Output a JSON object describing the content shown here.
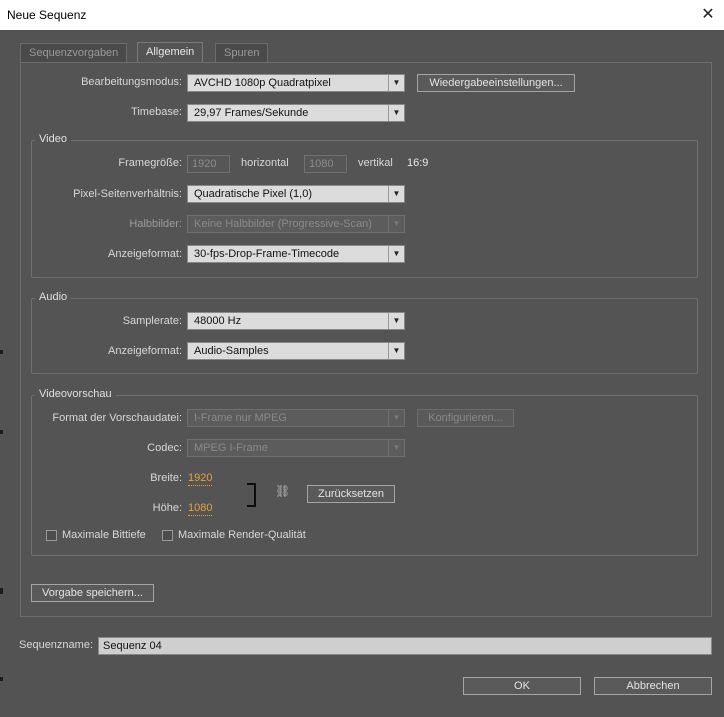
{
  "window": {
    "title": "Neue Sequenz"
  },
  "tabs": [
    {
      "label": "Sequenzvorgaben",
      "active": false
    },
    {
      "label": "Allgemein",
      "active": true
    },
    {
      "label": "Spuren",
      "active": false
    }
  ],
  "general": {
    "editing_mode_label": "Bearbeitungsmodus:",
    "editing_mode_value": "AVCHD 1080p Quadratpixel",
    "playback_settings_button": "Wiedergabeeinstellungen...",
    "timebase_label": "Timebase:",
    "timebase_value": "29,97 Frames/Sekunde"
  },
  "video": {
    "group_title": "Video",
    "frame_size_label": "Framegröße:",
    "frame_width": "1920",
    "horizontal_label": "horizontal",
    "frame_height": "1080",
    "vertical_label": "vertikal",
    "aspect_ratio": "16:9",
    "pixel_aspect_label": "Pixel-Seitenverhältnis:",
    "pixel_aspect_value": "Quadratische Pixel (1,0)",
    "fields_label": "Halbbilder:",
    "fields_value": "Keine Halbbilder (Progressive-Scan)",
    "display_format_label": "Anzeigeformat:",
    "display_format_value": "30-fps-Drop-Frame-Timecode"
  },
  "audio": {
    "group_title": "Audio",
    "sample_rate_label": "Samplerate:",
    "sample_rate_value": "48000 Hz",
    "display_format_label": "Anzeigeformat:",
    "display_format_value": "Audio-Samples"
  },
  "preview": {
    "group_title": "Videovorschau",
    "preview_format_label": "Format der Vorschaudatei:",
    "preview_format_value": "I-Frame nur MPEG",
    "configure_button": "Konfigurieren...",
    "codec_label": "Codec:",
    "codec_value": "MPEG I-Frame",
    "width_label": "Breite:",
    "width_value": "1920",
    "height_label": "Höhe:",
    "height_value": "1080",
    "reset_button": "Zurücksetzen",
    "max_bit_depth_label": "Maximale Bittiefe",
    "max_render_quality_label": "Maximale Render-Qualität"
  },
  "save_preset_button": "Vorgabe speichern...",
  "sequence_name": {
    "label": "Sequenzname:",
    "value": "Sequenz 04"
  },
  "footer": {
    "ok": "OK",
    "cancel": "Abbrechen"
  },
  "colors": {
    "dialog_bg": "#535353",
    "value_accent": "#e4a23a",
    "field_bg": "#dcdcdc"
  }
}
